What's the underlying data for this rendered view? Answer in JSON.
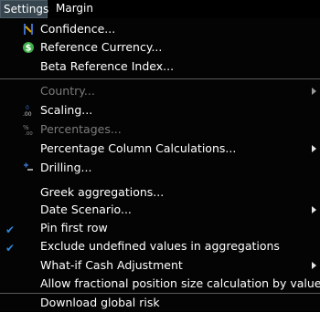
{
  "menubar": {
    "settings_label": "Settings",
    "margin_label": "Margin"
  },
  "menu": {
    "items": [
      {
        "label": "Confidence...",
        "icon": "confidence-icon"
      },
      {
        "label": "Reference Currency...",
        "icon": "dollar-icon"
      },
      {
        "label": "Beta Reference Index..."
      },
      {
        "label": "Country...",
        "disabled": true,
        "submenu": true
      },
      {
        "label": "Scaling...",
        "icon": "scaling-icon"
      },
      {
        "label": "Percentages...",
        "icon": "percentages-icon",
        "disabled": true
      },
      {
        "label": "Percentage Column Calculations...",
        "submenu": true
      },
      {
        "label": "Drilling...",
        "icon": "drilling-icon"
      },
      {
        "label": "Greek aggregations..."
      },
      {
        "label": "Date Scenario...",
        "submenu": true
      },
      {
        "label": "Pin first row",
        "checked": true
      },
      {
        "label": "Exclude undefined values in aggregations",
        "checked": true
      },
      {
        "label": "What-if Cash Adjustment",
        "submenu": true
      },
      {
        "label": "Allow fractional position size calculation by value"
      },
      {
        "label": "Download global risk"
      }
    ]
  },
  "colors": {
    "check": "#2f86d6",
    "dollar_icon": "#3fae49",
    "confidence_icon": "#3a6fc4",
    "disabled_text": "#7b7b7b"
  }
}
